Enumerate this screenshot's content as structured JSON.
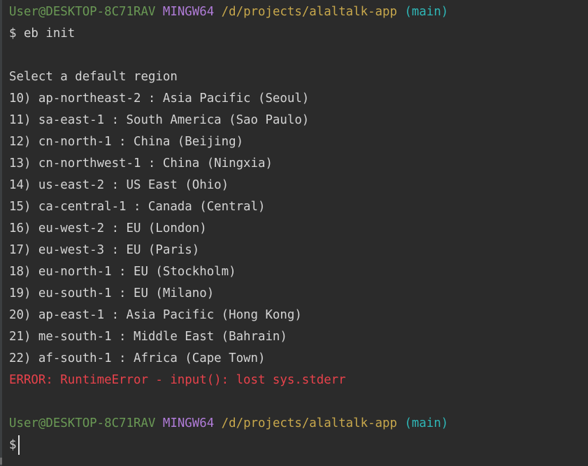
{
  "prompt1": {
    "user": "User@DESKTOP-8C71RAV",
    "system": "MINGW64",
    "path": "/d/projects/alaltalk-app",
    "branch": "(main)"
  },
  "command": "$ eb init",
  "select_heading": "Select a default region",
  "regions": [
    "10) ap-northeast-2 : Asia Pacific (Seoul)",
    "11) sa-east-1 : South America (Sao Paulo)",
    "12) cn-north-1 : China (Beijing)",
    "13) cn-northwest-1 : China (Ningxia)",
    "14) us-east-2 : US East (Ohio)",
    "15) ca-central-1 : Canada (Central)",
    "16) eu-west-2 : EU (London)",
    "17) eu-west-3 : EU (Paris)",
    "18) eu-north-1 : EU (Stockholm)",
    "19) eu-south-1 : EU (Milano)",
    "20) ap-east-1 : Asia Pacific (Hong Kong)",
    "21) me-south-1 : Middle East (Bahrain)",
    "22) af-south-1 : Africa (Cape Town)"
  ],
  "error_message": "ERROR: RuntimeError - input(): lost sys.stderr",
  "prompt2": {
    "user": "User@DESKTOP-8C71RAV",
    "system": "MINGW64",
    "path": "/d/projects/alaltalk-app",
    "branch": "(main)"
  },
  "final_prompt": "$",
  "colors": {
    "background": "#2b2b2b",
    "text": "#d4d4d4",
    "user": "#6a9955",
    "system": "#b07cd8",
    "path": "#c8a84c",
    "branch": "#2fb7b7",
    "error": "#e8424b"
  }
}
